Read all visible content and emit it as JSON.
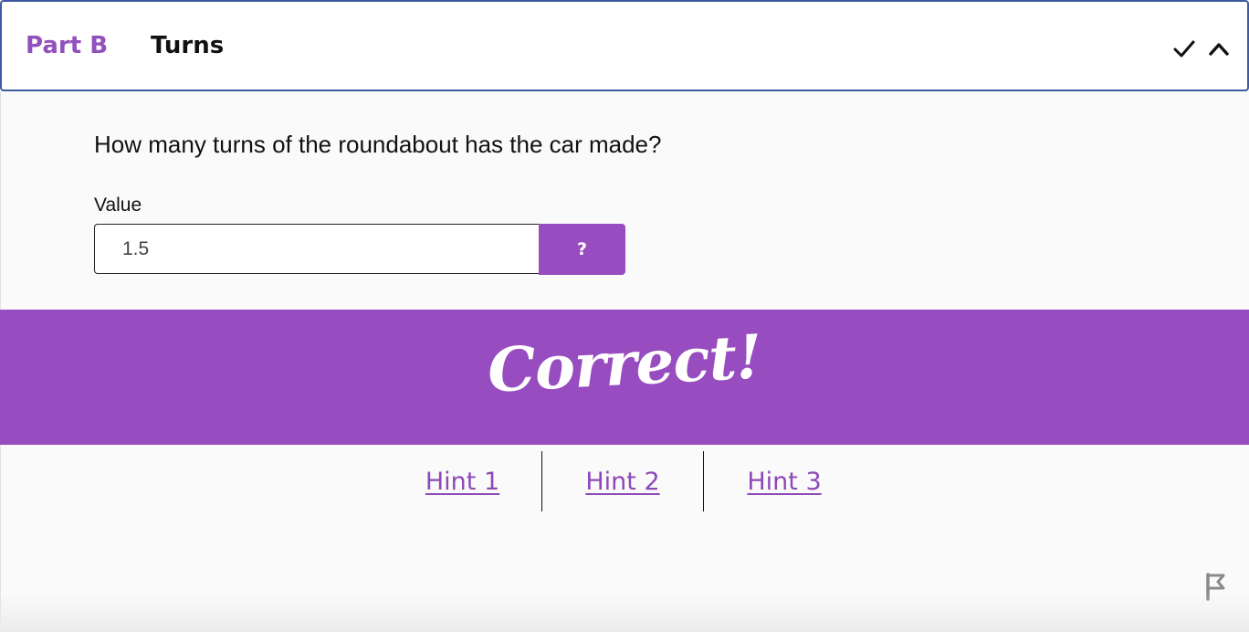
{
  "header": {
    "part_label": "Part B",
    "title": "Turns",
    "border_color": "#3e5aa1",
    "icons": [
      "check-icon",
      "chevron-up-icon"
    ]
  },
  "question": {
    "prompt": "How many turns of the roundabout has the car made?",
    "value_label": "Value",
    "value": "1.5",
    "help_label": "?"
  },
  "feedback": {
    "message": "Correct!",
    "color": "#974dbf"
  },
  "hints": [
    "Hint 1",
    "Hint 2",
    "Hint 3"
  ],
  "footer": {
    "icons": [
      "flag-icon"
    ]
  },
  "colors": {
    "accent": "#974dbf",
    "part_label": "#9150bb",
    "hint_link": "#8e49b7",
    "background": "#fafafa"
  }
}
